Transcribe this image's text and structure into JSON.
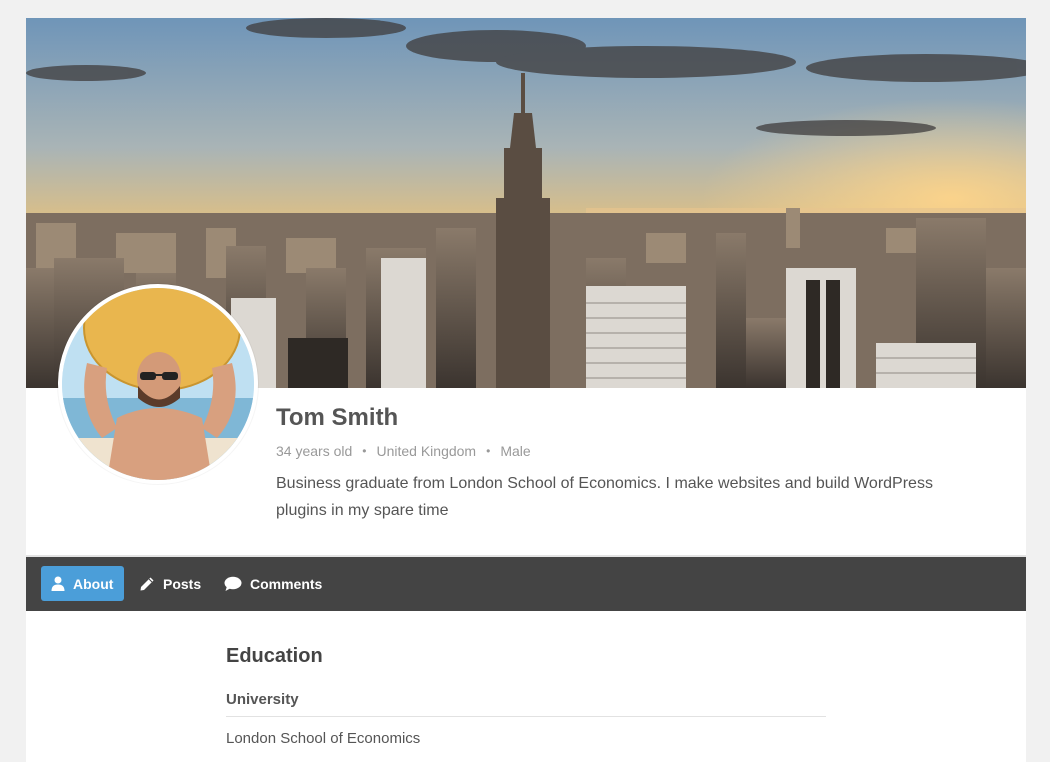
{
  "profile": {
    "name": "Tom Smith",
    "age": "34 years old",
    "country": "United Kingdom",
    "gender": "Male",
    "separator": "•",
    "bio": "Business graduate from London School of Economics. I make websites and build WordPress plugins in my spare time"
  },
  "nav": {
    "tabs": [
      {
        "label": "About",
        "icon": "user-icon",
        "active": true
      },
      {
        "label": "Posts",
        "icon": "pencil-icon",
        "active": false
      },
      {
        "label": "Comments",
        "icon": "speech-bubble-icon",
        "active": false
      }
    ]
  },
  "about": {
    "section_title": "Education",
    "fields": [
      {
        "label": "University",
        "value": "London School of Economics"
      }
    ]
  },
  "colors": {
    "accent": "#4b9ed9",
    "navbar": "#444444",
    "page_bg": "#f1f1f1"
  }
}
